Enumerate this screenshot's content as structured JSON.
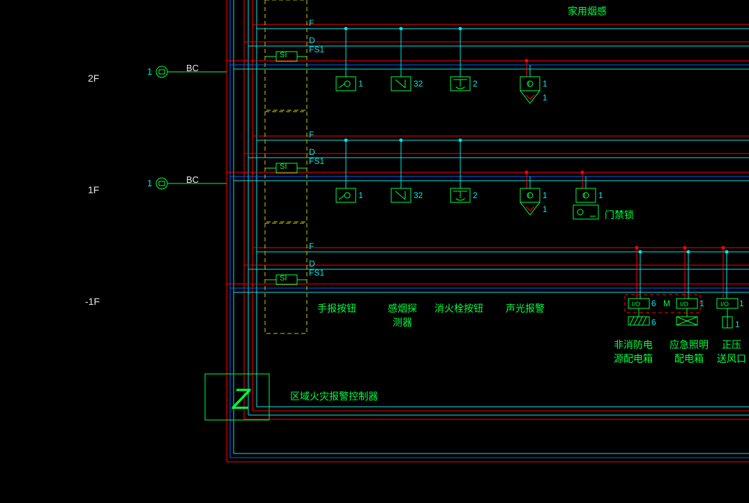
{
  "title_top": "家用烟感",
  "floors": {
    "f2": "2F",
    "f1": "1F",
    "fb1": "-1F"
  },
  "bc_label": "BC",
  "bc_qty": "1",
  "bus": {
    "f": "F",
    "d": "D",
    "fs1": "FS1"
  },
  "si": "SI",
  "devices": {
    "manual": {
      "label": "手报按钮",
      "qty": "1"
    },
    "smoke": {
      "label": "感烟探测器",
      "qty": "32"
    },
    "hydrant": {
      "label": "消火栓按钮",
      "qty": "2"
    },
    "av": {
      "label": "声光报警",
      "qty": "1",
      "qty2": "1"
    },
    "door": {
      "label": "门禁锁",
      "qty": "1"
    },
    "npower": {
      "label": "非消防电源配电箱",
      "qty": "6",
      "hatch_qty": "6"
    },
    "emlight": {
      "label": "应急照明配电箱",
      "qty": "1",
      "m": "M"
    },
    "damper": {
      "label": "正压送风口",
      "qty": "1",
      "qty2": "1"
    }
  },
  "io": "I/O",
  "controller": {
    "symbol": "Z",
    "label": "区域火灾报警控制器"
  }
}
